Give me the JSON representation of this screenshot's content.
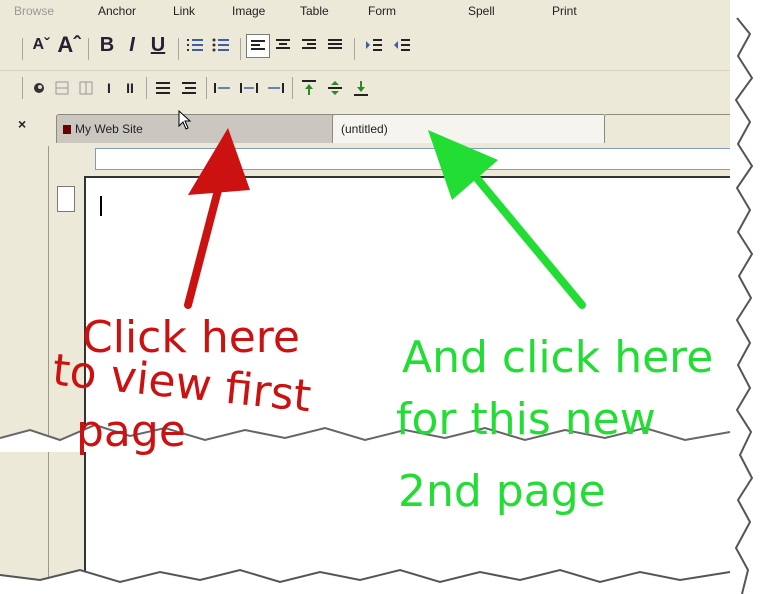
{
  "menubar": {
    "items": [
      "Browse",
      "Anchor",
      "Link",
      "Image",
      "Table",
      "Form",
      "Spell",
      "Print"
    ]
  },
  "toolbar": {
    "bold": "B",
    "italic": "I",
    "underline": "U"
  },
  "left_pane": {
    "close": "×"
  },
  "tabs": [
    {
      "label": "My Web Site"
    },
    {
      "label": "(untitled)"
    }
  ],
  "annotations": {
    "red_line1": "Click here",
    "red_line2": "to view first",
    "red_line3": "page",
    "green_line1": "And click here",
    "green_line2": "for this new",
    "green_line3": "2nd page"
  },
  "colors": {
    "red_ink": "#cc1111",
    "green_ink": "#22dd33",
    "chrome": "#ece9d8"
  }
}
